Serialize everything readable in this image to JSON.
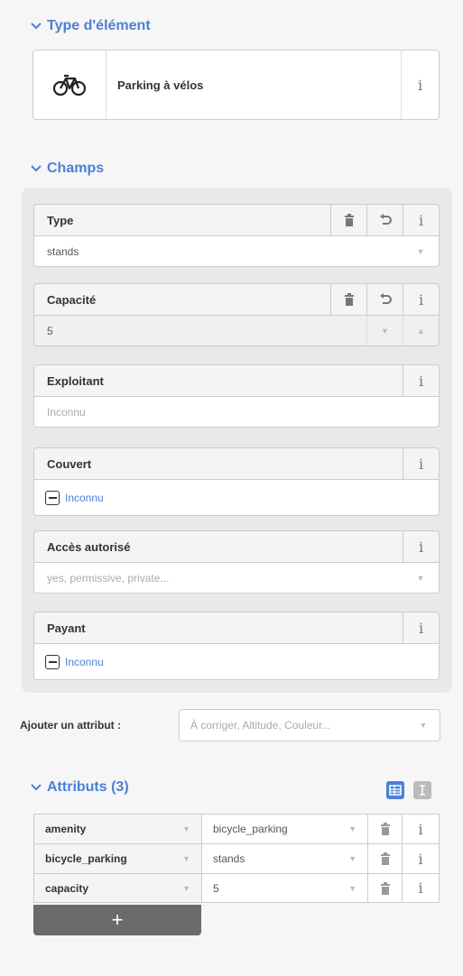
{
  "preset_section": {
    "title": "Type d'élément"
  },
  "preset": {
    "name": "Parking à vélos",
    "icon": "bicycle-icon",
    "info": "i"
  },
  "fields_section": {
    "title": "Champs"
  },
  "fields": {
    "type": {
      "label": "Type",
      "value": "stands"
    },
    "capacity": {
      "label": "Capacité",
      "value": "5"
    },
    "operator": {
      "label": "Exploitant",
      "placeholder": "Inconnu"
    },
    "covered": {
      "label": "Couvert",
      "value": "Inconnu"
    },
    "access": {
      "label": "Accès autorisé",
      "placeholder": "yes, permissive, private..."
    },
    "fee": {
      "label": "Payant",
      "value": "Inconnu"
    }
  },
  "add_attribute": {
    "label": "Ajouter un attribut :",
    "placeholder": "À corriger, Altitude, Couleur..."
  },
  "tags_section": {
    "title": "Attributs (3)"
  },
  "tags": [
    {
      "key": "amenity",
      "value": "bicycle_parking"
    },
    {
      "key": "bicycle_parking",
      "value": "stands"
    },
    {
      "key": "capacity",
      "value": "5"
    }
  ],
  "add_tag": {
    "label": "+"
  },
  "info_glyph": "i",
  "colors": {
    "accent": "#4b80d6",
    "panel_bg": "#e9e9e9",
    "add_tag_bg": "#6b6b6b"
  }
}
